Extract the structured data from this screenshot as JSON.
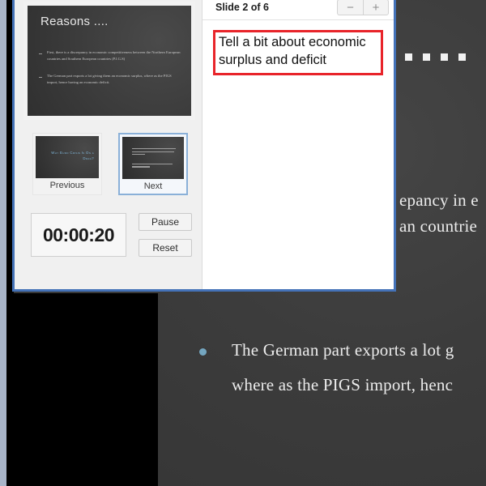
{
  "window": {
    "accent_border": "#4472b8"
  },
  "presenter": {
    "preview": {
      "title": "Reasons ....",
      "bullets": [
        "First, there is a discrepancy in economic competitiveness between the Northern European countries and Southern European countries (P.I.G.S)",
        "The German part exports a lot giving them an economic surplus, where as the PIGS import, hence having an economic deficit."
      ]
    },
    "thumbnails": [
      {
        "caption": "Previous",
        "slide_title": "Why Euro Crisis Is On a Drag?",
        "selected": false
      },
      {
        "caption": "Next",
        "slide_title": "",
        "selected": true
      }
    ],
    "timer": {
      "value": "00:00:20",
      "pause_label": "Pause",
      "reset_label": "Reset"
    },
    "notes_panel": {
      "slide_counter": "Slide 2 of 6",
      "zoom_out_label": "−",
      "zoom_in_label": "+",
      "note_text": "Tell a bit about economic surplus and deficit",
      "note_border_color": "#e8242a"
    }
  },
  "background_slide": {
    "clipped_lines": [
      "epancy in e",
      "an countrie"
    ],
    "bullet_lines": [
      "The German part exports a lot g",
      "where as the PIGS import, henc"
    ],
    "dot_count": 4
  }
}
